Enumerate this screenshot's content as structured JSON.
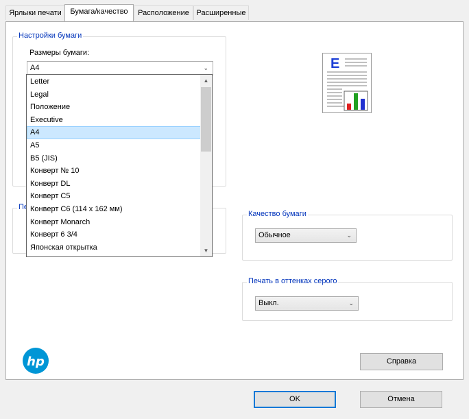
{
  "tabs": [
    {
      "label": "Ярлыки печати"
    },
    {
      "label": "Бумага/качество"
    },
    {
      "label": "Расположение"
    },
    {
      "label": "Расширенные"
    }
  ],
  "paper_settings": {
    "legend": "Настройки бумаги",
    "size_label": "Размеры бумаги:",
    "size_value": "A4",
    "size_options": [
      "Letter",
      "Legal",
      "Положение",
      "Executive",
      "A4",
      "A5",
      "B5 (JIS)",
      "Конверт № 10",
      "Конверт DL",
      "Конверт C5",
      "Конверт C6 (114 x 162 мм)",
      "Конверт Monarch",
      "Конверт 6 3/4",
      "Японская открытка"
    ],
    "selected_option": "A4"
  },
  "print_group": {
    "legend_partial": "Пе"
  },
  "paper_quality": {
    "legend": "Качество бумаги",
    "value": "Обычное"
  },
  "grayscale": {
    "legend": "Печать в оттенках серого",
    "value": "Выкл."
  },
  "preview": {
    "letter": "E",
    "colors": {
      "red": "#e02020",
      "green": "#20a020",
      "blue": "#2030d0",
      "letter": "#1c3fd6"
    }
  },
  "buttons": {
    "help": "Справка",
    "ok": "OK",
    "cancel": "Отмена"
  },
  "logo": {
    "text": "hp",
    "color": "#0096d6"
  }
}
